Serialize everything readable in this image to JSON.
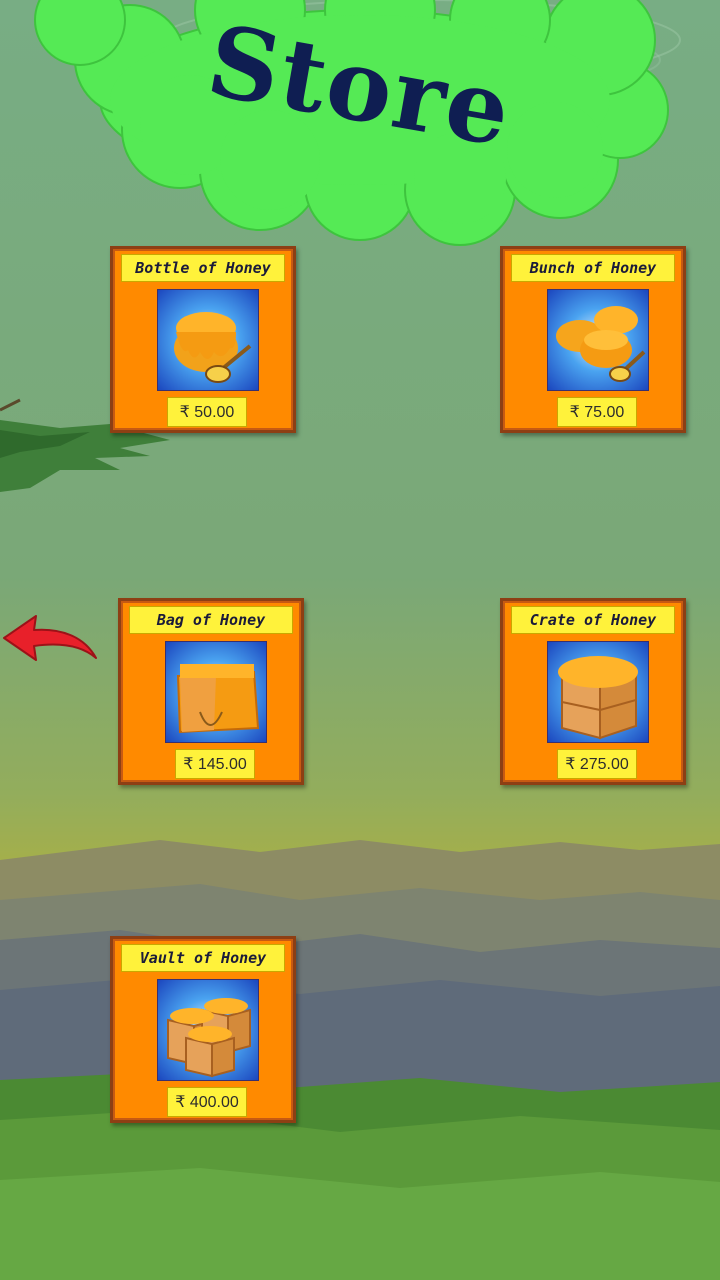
{
  "header": {
    "title": "Store"
  },
  "store": {
    "items": [
      {
        "name": "Bottle of Honey",
        "price": "₹ 50.00",
        "icon": "honey-bottle-icon"
      },
      {
        "name": "Bunch of Honey",
        "price": "₹ 75.00",
        "icon": "honey-bunch-icon"
      },
      {
        "name": "Bag of Honey",
        "price": "₹ 145.00",
        "icon": "honey-bag-icon"
      },
      {
        "name": "Crate of Honey",
        "price": "₹ 275.00",
        "icon": "honey-crate-icon"
      },
      {
        "name": "Vault of Honey",
        "price": "₹ 400.00",
        "icon": "honey-vault-icon"
      }
    ]
  },
  "navigation": {
    "back_icon": "back-arrow-icon"
  },
  "colors": {
    "card_bg": "#ff8a00",
    "label_bg": "#fff23b",
    "title_blob": "#55ea55",
    "title_text": "#0f1e52",
    "back_arrow": "#e8202a"
  }
}
